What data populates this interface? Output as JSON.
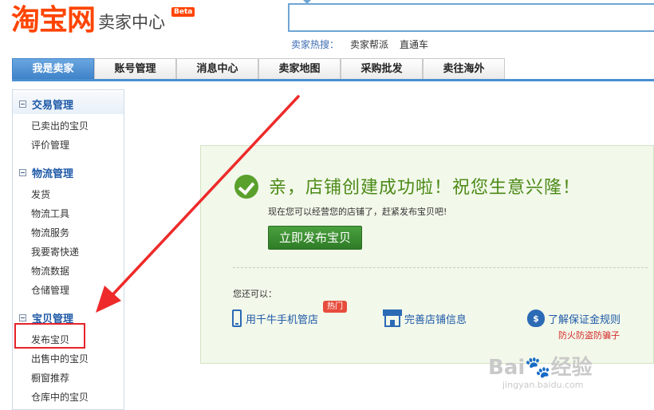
{
  "header": {
    "logo_main": "淘宝网",
    "logo_sub": "卖家中心",
    "beta": "Beta",
    "search_placeholder": "",
    "hot_label": "卖家热搜：",
    "hot_links": [
      "卖家帮派",
      "直通车"
    ]
  },
  "nav": {
    "tabs": [
      "我是卖家",
      "账号管理",
      "消息中心",
      "卖家地图",
      "采购批发",
      "卖往海外"
    ]
  },
  "sidebar": {
    "sections": [
      {
        "title": "交易管理",
        "items": [
          "已卖出的宝贝",
          "评价管理"
        ]
      },
      {
        "title": "物流管理",
        "items": [
          "发货",
          "物流工具",
          "物流服务",
          "我要寄快递",
          "物流数据",
          "仓储管理"
        ]
      },
      {
        "title": "宝贝管理",
        "items": [
          "发布宝贝",
          "出售中的宝贝",
          "橱窗推荐",
          "仓库中的宝贝"
        ]
      }
    ]
  },
  "main": {
    "headline": "亲，店铺创建成功啦！祝您生意兴隆！",
    "subline": "现在您可以经营您的店铺了，赶紧发布宝贝吧!",
    "publish_button": "立即发布宝贝",
    "also_label": "您还可以：",
    "links": {
      "mobile": "用千牛手机管店",
      "shop_info": "完善店铺信息",
      "deposit": "了解保证金规则",
      "hot_badge": "热门",
      "deposit_note": "防火防盗防骗子",
      "deposit_icon_text": "$"
    }
  },
  "watermark": {
    "main": "Bai🐾经验",
    "sub": "jingyan.baidu.com"
  },
  "colors": {
    "brand": "#ff4400",
    "nav_active": "#3f82c9",
    "success_green": "#4c8a17",
    "link_blue": "#1f5aa8",
    "annotation_red": "#e6232a"
  }
}
